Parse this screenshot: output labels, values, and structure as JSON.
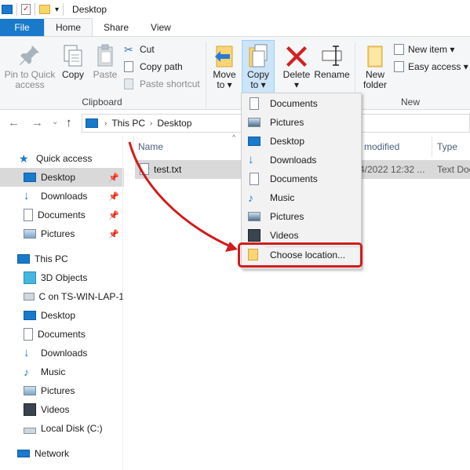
{
  "window": {
    "title": "Desktop"
  },
  "tabs": [
    {
      "label": "File"
    },
    {
      "label": "Home"
    },
    {
      "label": "Share"
    },
    {
      "label": "View"
    }
  ],
  "ribbon": {
    "pin_label_1": "Pin to Quick",
    "pin_label_2": "access",
    "copy_label": "Copy",
    "paste_label": "Paste",
    "cut_label": "Cut",
    "copy_path_label": "Copy path",
    "paste_shortcut_label": "Paste shortcut",
    "clipboard_group": "Clipboard",
    "move_to_1": "Move",
    "move_to_2": "to ▾",
    "copy_to_1": "Copy",
    "copy_to_2": "to ▾",
    "delete_1": "Delete",
    "delete_2": "▾",
    "rename_label": "Rename",
    "new_folder_1": "New",
    "new_folder_2": "folder",
    "new_item_label": "New item ▾",
    "easy_access_label": "Easy access ▾",
    "new_group": "New"
  },
  "address": {
    "crumbs": [
      "This PC",
      "Desktop"
    ]
  },
  "sidebar": {
    "quick_access": "Quick access",
    "quick_items": [
      {
        "label": "Desktop"
      },
      {
        "label": "Downloads"
      },
      {
        "label": "Documents"
      },
      {
        "label": "Pictures"
      }
    ],
    "this_pc": "This PC",
    "pc_items": [
      {
        "label": "3D Objects"
      },
      {
        "label": "C on TS-WIN-LAP-1"
      },
      {
        "label": "Desktop"
      },
      {
        "label": "Documents"
      },
      {
        "label": "Downloads"
      },
      {
        "label": "Music"
      },
      {
        "label": "Pictures"
      },
      {
        "label": "Videos"
      },
      {
        "label": "Local Disk (C:)"
      }
    ],
    "network": "Network"
  },
  "filelist": {
    "columns": [
      "Name",
      "modified",
      "Type"
    ],
    "rows": [
      {
        "name": "test.txt",
        "modified": "4/2022 12:32 ...",
        "type": "Text Doc"
      }
    ]
  },
  "dropdown": {
    "items": [
      {
        "label": "Documents"
      },
      {
        "label": "Pictures"
      },
      {
        "label": "Desktop"
      },
      {
        "label": "Downloads"
      },
      {
        "label": "Documents"
      },
      {
        "label": "Music"
      },
      {
        "label": "Pictures"
      },
      {
        "label": "Videos"
      }
    ],
    "choose_location": "Choose location..."
  },
  "colors": {
    "accent": "#1979ca",
    "highlight": "#cce4f7",
    "annotation_red": "#d01c1c"
  }
}
